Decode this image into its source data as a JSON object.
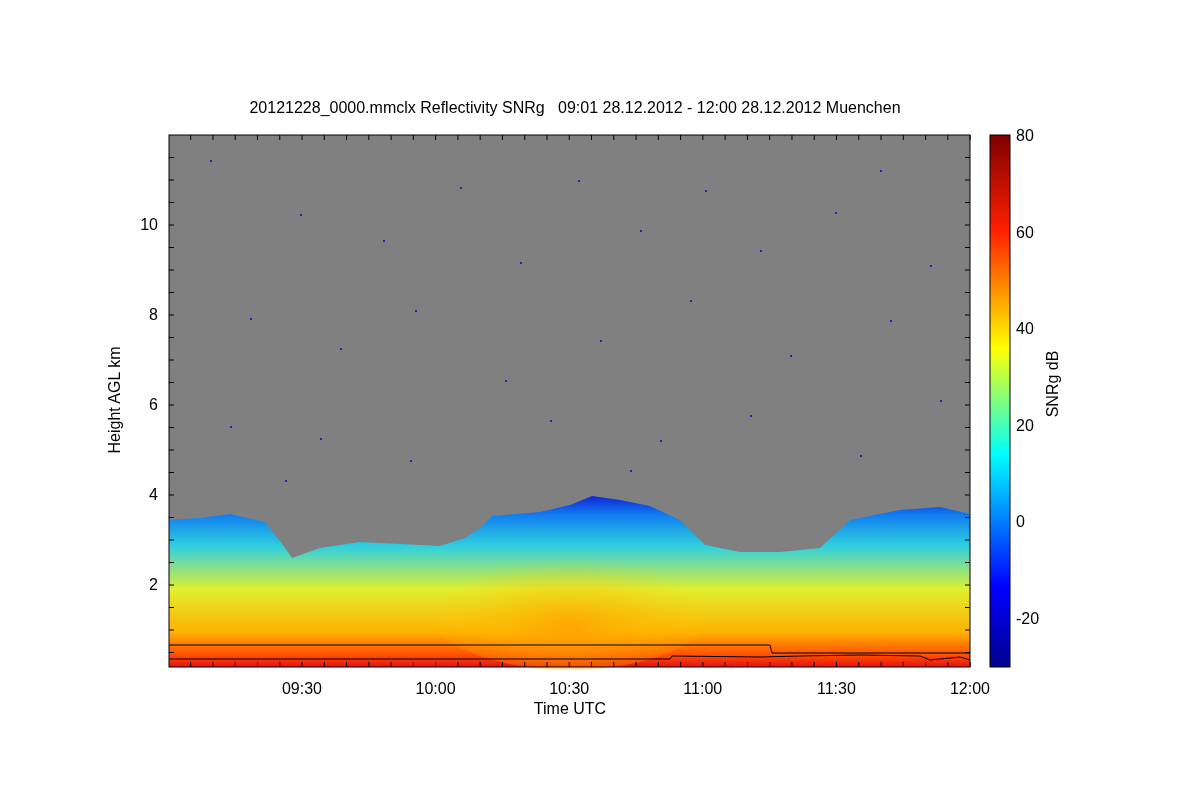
{
  "plot": {
    "title": "20121228_0000.mmclx Reflectivity SNRg   09:01 28.12.2012 - 12:00 28.12.2012 Muenchen",
    "x_axis": {
      "label": "Time UTC",
      "ticks": [
        "09:30",
        "10:00",
        "10:30",
        "11:00",
        "11:30",
        "12:00"
      ]
    },
    "y_axis": {
      "label": "Height AGL km",
      "ticks": [
        "10",
        "8",
        "6",
        "4",
        "2"
      ]
    },
    "colorbar": {
      "label": "SNRg dB",
      "ticks": [
        "80",
        "60",
        "40",
        "20",
        "0",
        "-20"
      ]
    }
  }
}
